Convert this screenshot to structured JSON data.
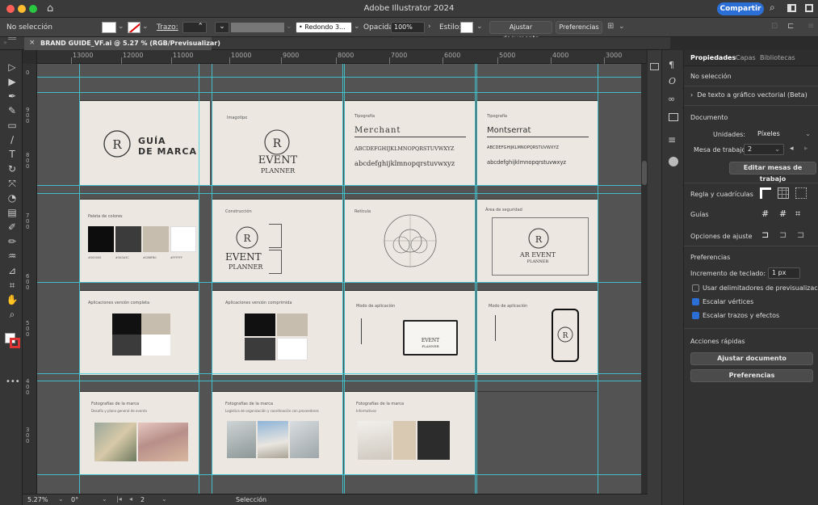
{
  "window": {
    "title": "Adobe Illustrator 2024",
    "share_label": "Compartir"
  },
  "control": {
    "selection": "No selección",
    "stroke_label": "Trazo:",
    "stroke_value": "",
    "brush_label": "Redondo 3...",
    "opacity_label": "Opacidad:",
    "opacity_value": "100%",
    "style_label": "Estilo:",
    "fit_button": "Ajustar documento",
    "prefs_button": "Preferencias"
  },
  "document": {
    "tab_title": "BRAND GUIDE_VF.ai @ 5.27 % (RGB/Previsualizar)"
  },
  "ruler": {
    "h_ticks": [
      "13000",
      "12000",
      "11000",
      "10000",
      "9000",
      "8000",
      "7000",
      "6000",
      "5000",
      "4000",
      "3000"
    ],
    "v_ticks": [
      "0",
      "900",
      "800",
      "700",
      "600",
      "500",
      "400",
      "300"
    ]
  },
  "status": {
    "zoom": "5.27%",
    "rotation": "0°",
    "artboard_num": "2",
    "tool": "Selección"
  },
  "panel": {
    "tabs": [
      "Propiedades",
      "Capas",
      "Bibliotecas"
    ],
    "no_selection": "No selección",
    "vector_text": "De texto a gráfico vectorial (Beta)",
    "document_heading": "Documento",
    "units_label": "Unidades:",
    "units_value": "Píxeles",
    "artboard_label": "Mesa de trabajo:",
    "artboard_value": "2",
    "edit_artboards": "Editar mesas de trabajo",
    "rulers_grids": "Regla y cuadrículas",
    "guides": "Guías",
    "snap_options": "Opciones de ajuste",
    "preferences_heading": "Preferencias",
    "keyboard_inc_label": "Incremento de teclado:",
    "keyboard_inc_value": "1 px",
    "chk_preview": "Usar delimitadores de previsualización",
    "chk_vertices": "Escalar vértices",
    "chk_strokes": "Escalar trazos y efectos",
    "quick_actions": "Acciones rápidas",
    "qa_fit": "Ajustar documento",
    "qa_prefs": "Preferencias"
  },
  "artboards": {
    "a1": {
      "line1": "GUÍA",
      "line2": "DE MARCA"
    },
    "a2": {
      "heading": "Imagotipo",
      "word1": "EVENT",
      "word2": "PLANNER"
    },
    "a3": {
      "heading": "Tipografía",
      "font": "Merchant",
      "upper": "ABCDEFGHIJKLMNOPQRSTUVWXYZ",
      "lower": "abcdefghijklmnopqrstuvwxyz"
    },
    "a4": {
      "heading": "Tipografía",
      "font": "Montserrat",
      "upper": "ABCDEFGHIJKLMNOPQRSTUVWXYZ",
      "lower": "abcdefghijklmnopqrstuvwxyz"
    },
    "a5": {
      "heading": "Paleta de colores",
      "codes": [
        "#000000",
        "#3A3A3C",
        "#C8BFB0",
        "#FFFFFF"
      ],
      "swatches": [
        "#0d0d0d",
        "#3b3b3c",
        "#c6bdae",
        "#ffffff"
      ]
    },
    "a6": {
      "heading": "Construcción",
      "word1": "EVENT",
      "word2": "PLANNER"
    },
    "a7": {
      "heading": "Retícula"
    },
    "a8": {
      "heading": "Área de seguridad",
      "word1": "AR EVENT",
      "word2": "PLANNER"
    },
    "a9": {
      "heading": "Aplicaciones versión completa"
    },
    "a10": {
      "heading": "Aplicaciones versión comprimida"
    },
    "a11": {
      "heading": "Modo de aplicación",
      "word1": "EVENT",
      "word2": "PLANNER"
    },
    "a12": {
      "heading": "Modo de aplicación"
    },
    "a13": {
      "heading": "Fotografías de la marca",
      "sub": "Desafío y plano general de evento"
    },
    "a14": {
      "heading": "Fotografías de la marca",
      "sub": "Logística de organización y coordinación con proveedores"
    },
    "a15": {
      "heading": "Fotografías de la marca",
      "sub": "Informativos"
    }
  },
  "colors": {
    "guide": "#3fd0dc",
    "accent": "#2b6ed6",
    "artboard": "#ece7e0"
  }
}
